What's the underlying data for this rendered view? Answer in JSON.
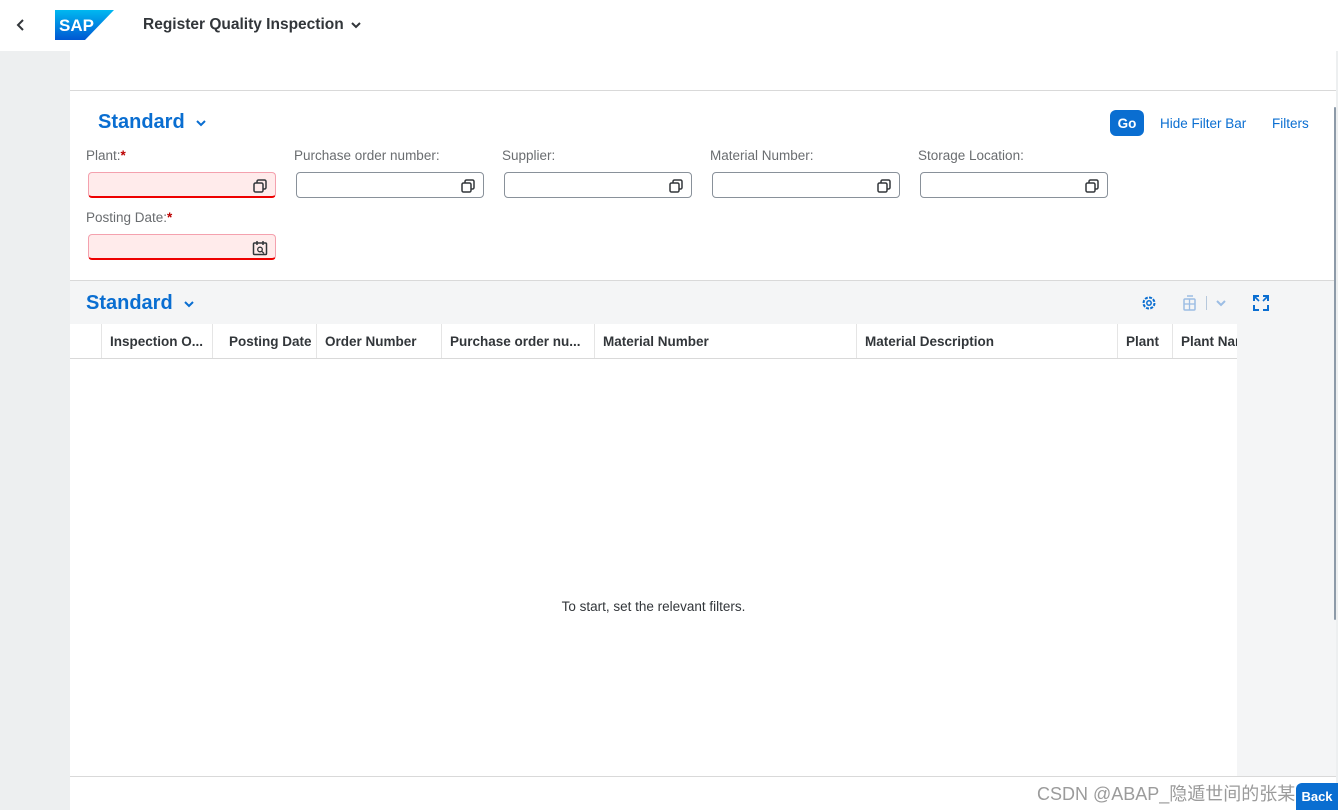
{
  "shell": {
    "logo_text": "SAP",
    "app_title": "Register Quality Inspection"
  },
  "filterbar": {
    "variant": "Standard",
    "go": "Go",
    "hide_filter_bar": "Hide Filter Bar",
    "filters": "Filters",
    "fields": [
      {
        "label": "Plant:",
        "required": true,
        "value": ""
      },
      {
        "label": "Purchase order number:",
        "required": false,
        "value": ""
      },
      {
        "label": "Supplier:",
        "required": false,
        "value": ""
      },
      {
        "label": "Material Number:",
        "required": false,
        "value": ""
      },
      {
        "label": "Storage Location:",
        "required": false,
        "value": ""
      },
      {
        "label": "Posting Date:",
        "required": true,
        "value": ""
      }
    ],
    "required_mark": "*"
  },
  "table": {
    "variant": "Standard",
    "columns": [
      "Inspection O...",
      "Posting Date",
      "Order Number",
      "Purchase order nu...",
      "Material Number",
      "Material Description",
      "Plant",
      "Plant Nar"
    ],
    "empty_text": "To start, set the relevant filters."
  },
  "watermark": "CSDN @ABAP_隐遁世间的张某人",
  "back_button": "Back",
  "colors": {
    "accent": "#0a6ed1",
    "error": "#bb0000",
    "error_bg": "#ffebeb"
  },
  "icons": [
    "back-icon",
    "chevron-down-icon",
    "value-help-icon",
    "calendar-icon",
    "gear-icon",
    "export-icon",
    "fullscreen-icon"
  ]
}
